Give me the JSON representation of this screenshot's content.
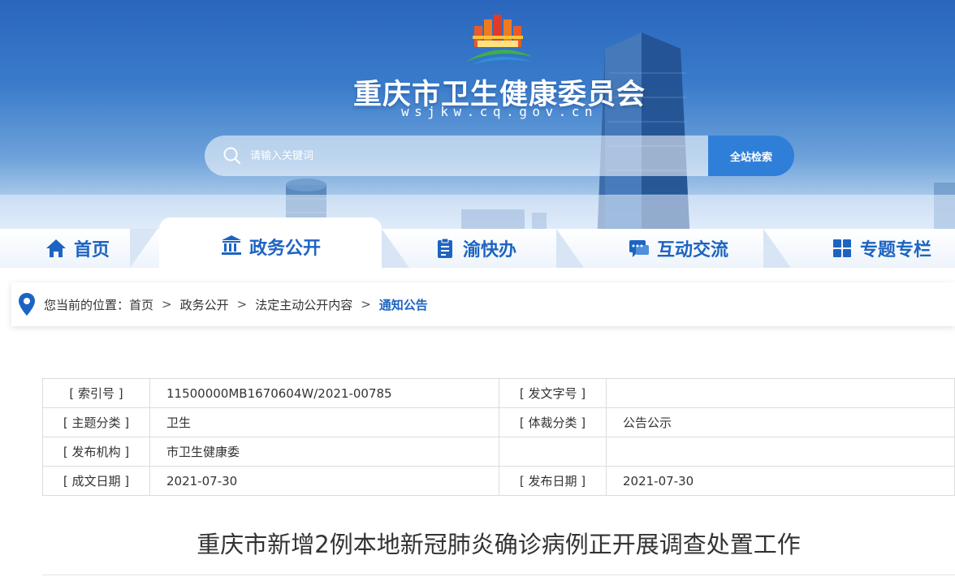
{
  "header": {
    "site_title": "重庆市卫生健康委员会",
    "site_domain": "wsjkw.cq.gov.cn"
  },
  "search": {
    "placeholder": "请输入关键词",
    "button_label": "全站检索"
  },
  "nav": {
    "tabs": [
      {
        "label": "首页",
        "icon": "home-icon",
        "active": false
      },
      {
        "label": "政务公开",
        "icon": "government-building-icon",
        "active": true
      },
      {
        "label": "渝快办",
        "icon": "clipboard-icon",
        "active": false
      },
      {
        "label": "互动交流",
        "icon": "chat-bubble-icon",
        "active": false
      },
      {
        "label": "专题专栏",
        "icon": "grid-icon",
        "active": false
      }
    ]
  },
  "breadcrumb": {
    "prefix": "您当前的位置：",
    "items": [
      "首页",
      "政务公开",
      "法定主动公开内容",
      "通知公告"
    ],
    "separator": ">"
  },
  "meta": {
    "index_no_label": "[ 索引号 ]",
    "index_no": "11500000MB1670604W/2021-00785",
    "doc_no_label": "[ 发文字号 ]",
    "doc_no": "",
    "topic_label": "[ 主题分类 ]",
    "topic": "卫生",
    "genre_label": "[ 体裁分类 ]",
    "genre": "公告公示",
    "publisher_label": "[ 发布机构 ]",
    "publisher": "市卫生健康委",
    "created_label": "[ 成文日期 ]",
    "created": "2021-07-30",
    "published_label": "[ 发布日期 ]",
    "published": "2021-07-30"
  },
  "article": {
    "title": "重庆市新增2例本地新冠肺炎确诊病例正开展调查处置工作"
  },
  "colors": {
    "primary": "#1d64c2",
    "search_button": "#2f7fd9"
  }
}
